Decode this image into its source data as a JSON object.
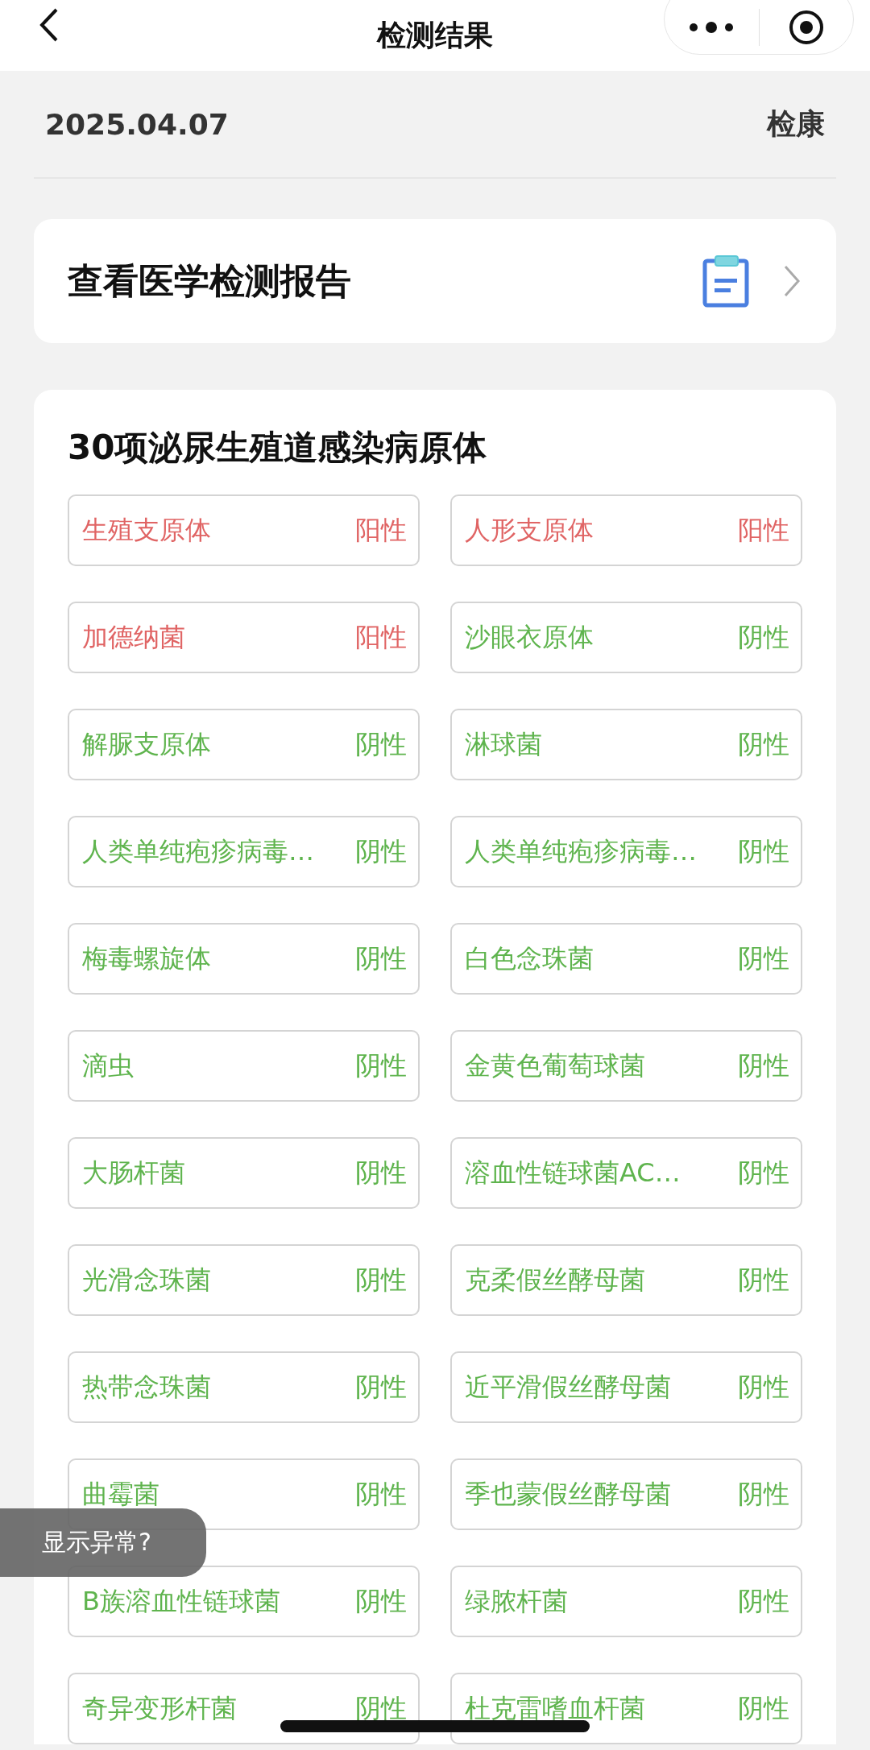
{
  "nav": {
    "title": "检测结果"
  },
  "header": {
    "date": "2025.04.07",
    "brand": "检康"
  },
  "report_link": {
    "label": "查看医学检测报告"
  },
  "panel": {
    "title": "30项泌尿生殖道感染病原体",
    "items": [
      {
        "name": "生殖支原体",
        "result": "阳性",
        "positive": true
      },
      {
        "name": "人形支原体",
        "result": "阳性",
        "positive": true
      },
      {
        "name": "加德纳菌",
        "result": "阳性",
        "positive": true
      },
      {
        "name": "沙眼衣原体",
        "result": "阴性",
        "positive": false
      },
      {
        "name": "解脲支原体",
        "result": "阴性",
        "positive": false
      },
      {
        "name": "淋球菌",
        "result": "阴性",
        "positive": false
      },
      {
        "name": "人类单纯疱疹病毒…",
        "result": "阴性",
        "positive": false
      },
      {
        "name": "人类单纯疱疹病毒…",
        "result": "阴性",
        "positive": false
      },
      {
        "name": "梅毒螺旋体",
        "result": "阴性",
        "positive": false
      },
      {
        "name": "白色念珠菌",
        "result": "阴性",
        "positive": false
      },
      {
        "name": "滴虫",
        "result": "阴性",
        "positive": false
      },
      {
        "name": "金黄色葡萄球菌",
        "result": "阴性",
        "positive": false
      },
      {
        "name": "大肠杆菌",
        "result": "阴性",
        "positive": false
      },
      {
        "name": "溶血性链球菌AC…",
        "result": "阴性",
        "positive": false
      },
      {
        "name": "光滑念珠菌",
        "result": "阴性",
        "positive": false
      },
      {
        "name": "克柔假丝酵母菌",
        "result": "阴性",
        "positive": false
      },
      {
        "name": "热带念珠菌",
        "result": "阴性",
        "positive": false
      },
      {
        "name": "近平滑假丝酵母菌",
        "result": "阴性",
        "positive": false
      },
      {
        "name": "曲霉菌",
        "result": "阴性",
        "positive": false
      },
      {
        "name": "季也蒙假丝酵母菌",
        "result": "阴性",
        "positive": false
      },
      {
        "name": "B族溶血性链球菌",
        "result": "阴性",
        "positive": false
      },
      {
        "name": "绿脓杆菌",
        "result": "阴性",
        "positive": false
      },
      {
        "name": "奇异变形杆菌",
        "result": "阴性",
        "positive": false
      },
      {
        "name": "杜克雷嗜血杆菌",
        "result": "阴性",
        "positive": false
      }
    ]
  },
  "toast": {
    "text": "显示异常?"
  }
}
